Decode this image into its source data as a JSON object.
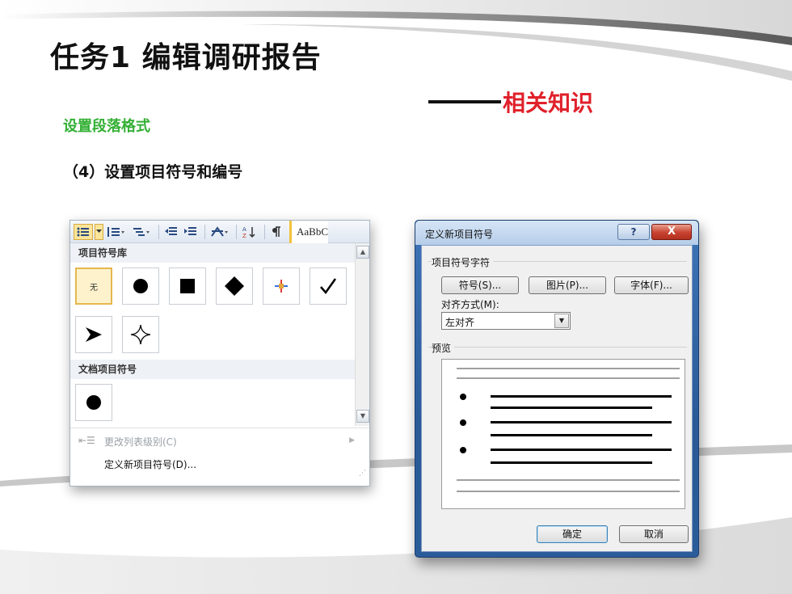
{
  "slide": {
    "title": "任务1 编辑调研报告",
    "subtitle_dash": "——",
    "subtitle": "相关知识",
    "section": "设置段落格式",
    "step": "（4）设置项目符号和编号"
  },
  "bullet_menu": {
    "ribbon": {
      "style_preview": "AaBbC",
      "sort_label": "A↓"
    },
    "library_header": "项目符号库",
    "none_label": "无",
    "document_header": "文档项目符号",
    "change_level_label": "更改列表级别(C)",
    "define_new_label": "定义新项目符号(D)...",
    "bullets": [
      "none",
      "filled-circle",
      "filled-square",
      "filled-diamond",
      "multicolor-star",
      "checkmark",
      "arrowhead",
      "four-point-star"
    ]
  },
  "dialog": {
    "title": "定义新项目符号",
    "help_label": "?",
    "close_label": "X",
    "group_bullet_char": "项目符号字符",
    "symbol_button": "符号(S)...",
    "picture_button": "图片(P)...",
    "font_button": "字体(F)...",
    "alignment_label": "对齐方式(M):",
    "alignment_value": "左对齐",
    "preview_label": "预览",
    "ok_button": "确定",
    "cancel_button": "取消"
  }
}
